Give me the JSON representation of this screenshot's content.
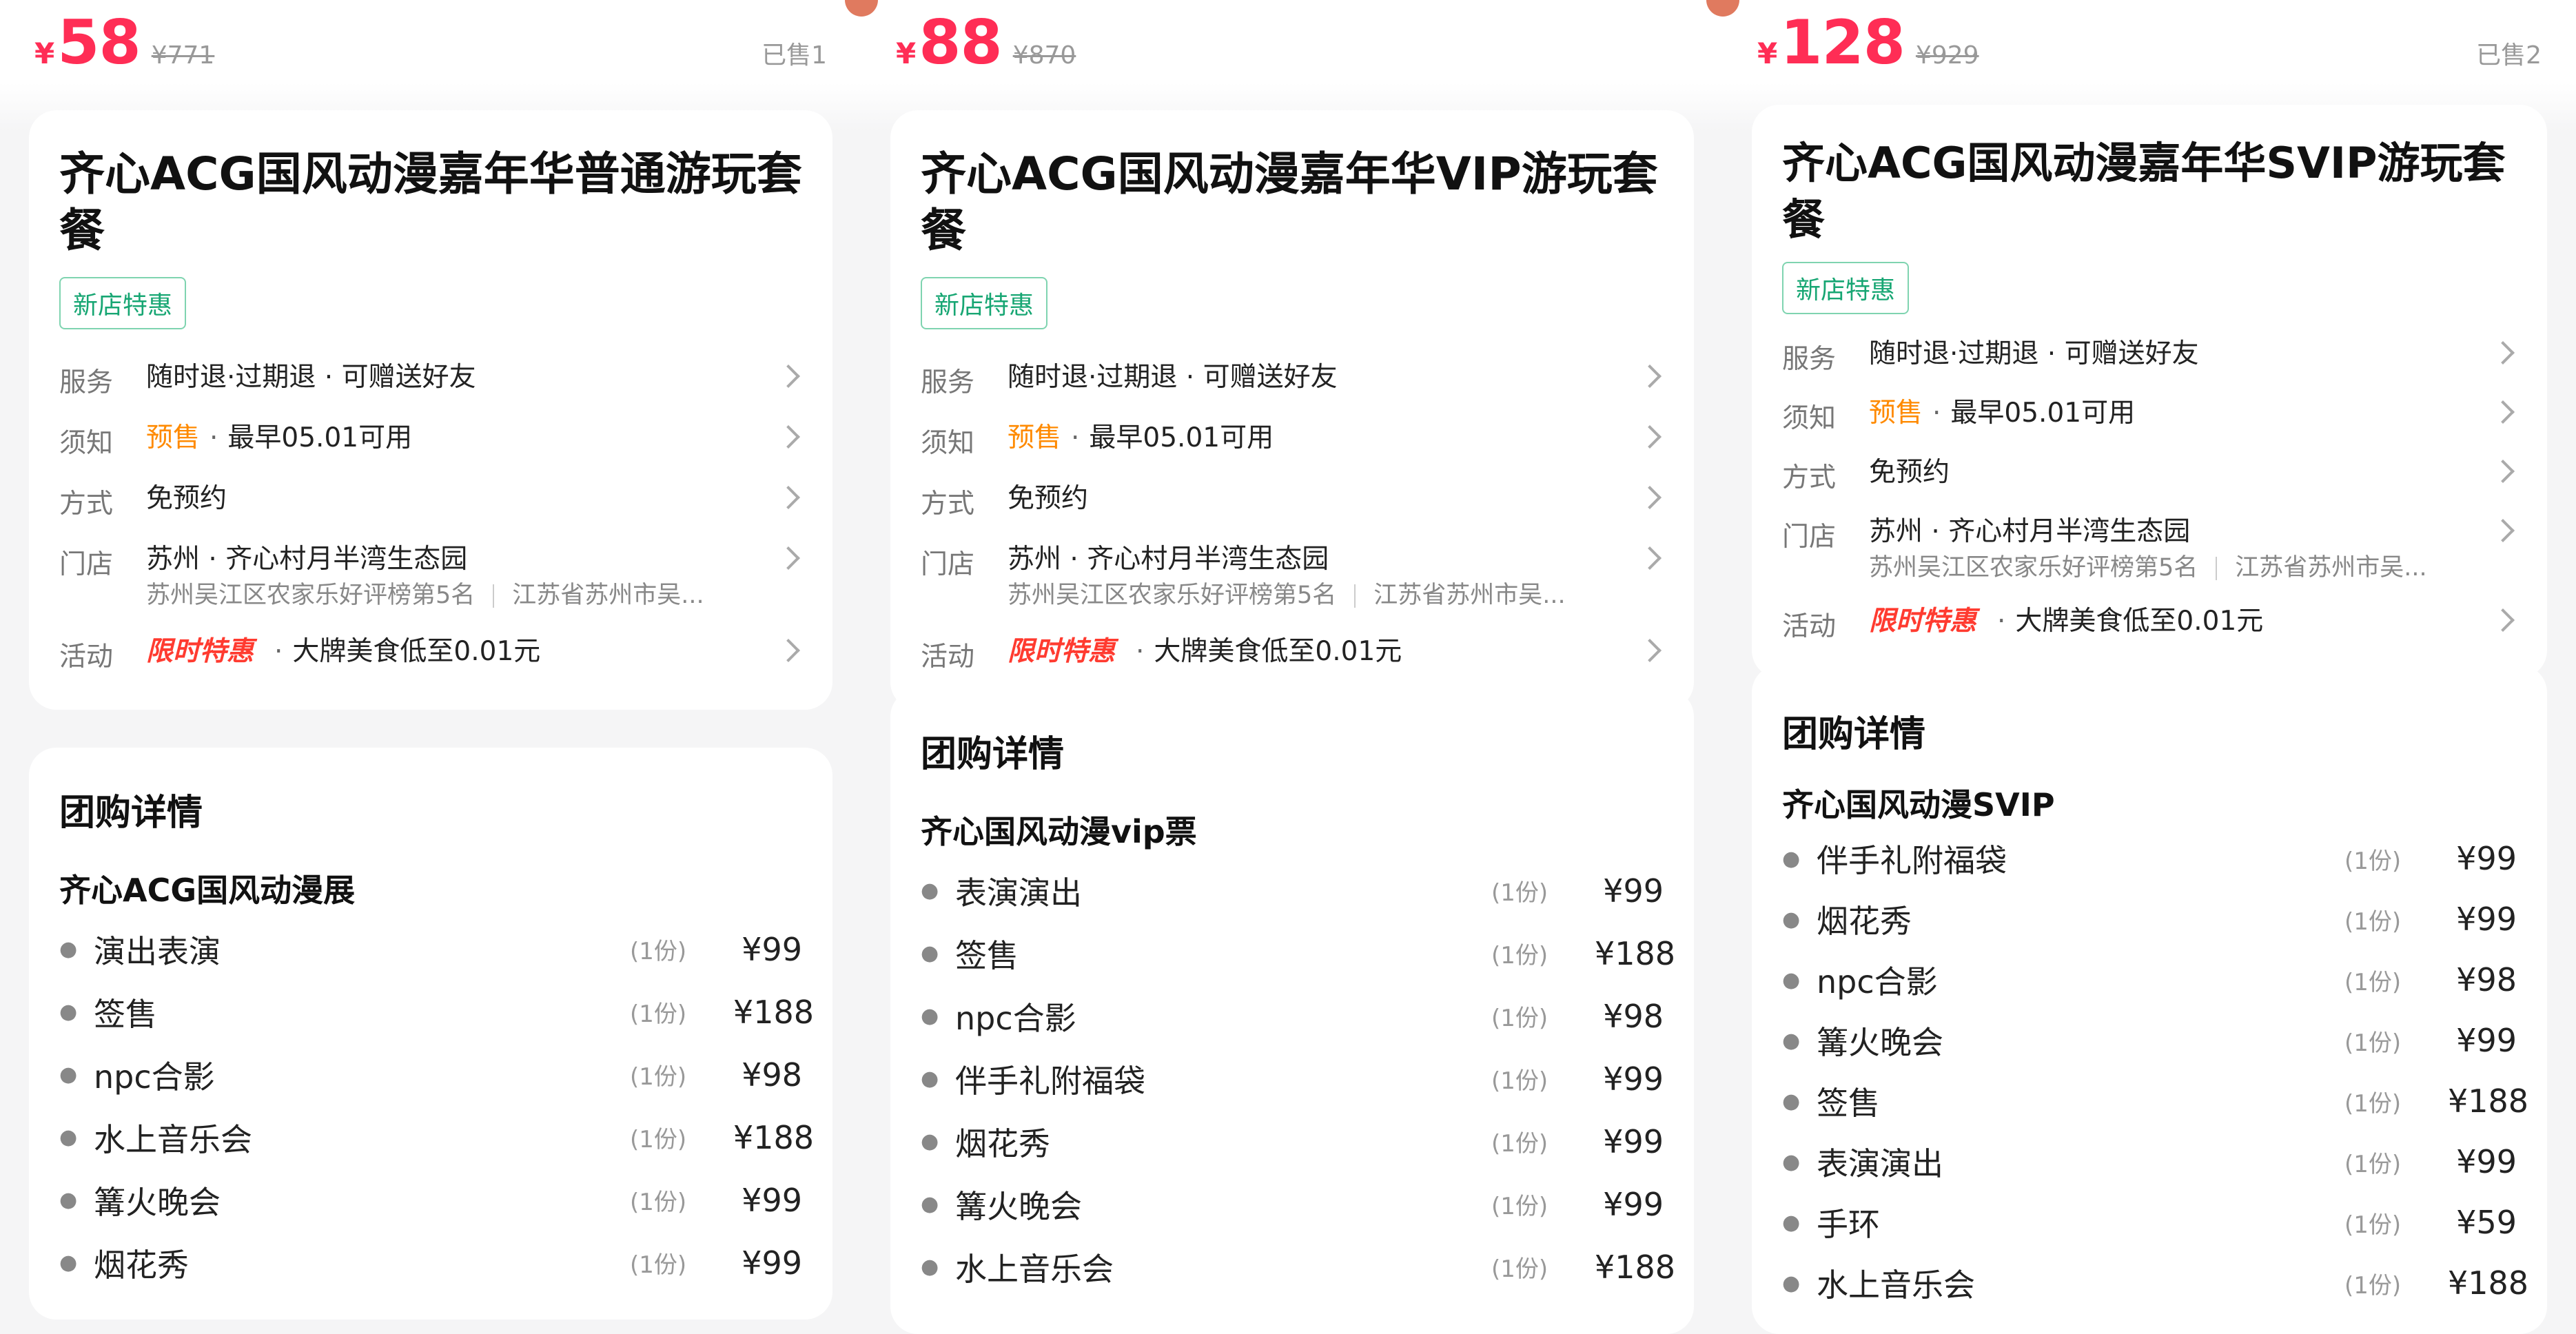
{
  "accent_color": "#ff2d55",
  "columns": [
    {
      "currency": "¥",
      "price": "58",
      "original_price": "¥771",
      "sold": "已售1",
      "title": "齐心ACG国风动漫嘉年华普通游玩套餐",
      "tag": "新店特惠",
      "service_label": "服务",
      "service_value": "随时退·过期退 · 可赠送好友",
      "notice_label": "须知",
      "notice_highlight": "预售",
      "notice_value": "最早05.01可用",
      "method_label": "方式",
      "method_value": "免预约",
      "store_label": "门店",
      "store_value": "苏州 · 齐心村月半湾生态园",
      "store_rank": "苏州吴江区农家乐好评榜第5名",
      "store_addr": "江苏省苏州市吴...",
      "activity_label": "活动",
      "activity_highlight": "限时特惠",
      "activity_value": "大牌美食低至0.01元",
      "detail_heading": "团购详情",
      "package_name": "齐心ACG国风动漫展",
      "items": [
        {
          "name": "演出表演",
          "qty": "(1份)",
          "price": "¥99"
        },
        {
          "name": "签售",
          "qty": "(1份)",
          "price": "¥188"
        },
        {
          "name": "npc合影",
          "qty": "(1份)",
          "price": "¥98"
        },
        {
          "name": "水上音乐会",
          "qty": "(1份)",
          "price": "¥188"
        },
        {
          "name": "篝火晚会",
          "qty": "(1份)",
          "price": "¥99"
        },
        {
          "name": "烟花秀",
          "qty": "(1份)",
          "price": "¥99"
        }
      ]
    },
    {
      "currency": "¥",
      "price": "88",
      "original_price": "¥870",
      "sold": "",
      "title": "齐心ACG国风动漫嘉年华VIP游玩套餐",
      "tag": "新店特惠",
      "service_label": "服务",
      "service_value": "随时退·过期退 · 可赠送好友",
      "notice_label": "须知",
      "notice_highlight": "预售",
      "notice_value": "最早05.01可用",
      "method_label": "方式",
      "method_value": "免预约",
      "store_label": "门店",
      "store_value": "苏州 · 齐心村月半湾生态园",
      "store_rank": "苏州吴江区农家乐好评榜第5名",
      "store_addr": "江苏省苏州市吴...",
      "activity_label": "活动",
      "activity_highlight": "限时特惠",
      "activity_value": "大牌美食低至0.01元",
      "detail_heading": "团购详情",
      "package_name": "齐心国风动漫vip票",
      "items": [
        {
          "name": "表演演出",
          "qty": "(1份)",
          "price": "¥99"
        },
        {
          "name": "签售",
          "qty": "(1份)",
          "price": "¥188"
        },
        {
          "name": "npc合影",
          "qty": "(1份)",
          "price": "¥98"
        },
        {
          "name": "伴手礼附福袋",
          "qty": "(1份)",
          "price": "¥99"
        },
        {
          "name": "烟花秀",
          "qty": "(1份)",
          "price": "¥99"
        },
        {
          "name": "篝火晚会",
          "qty": "(1份)",
          "price": "¥99"
        },
        {
          "name": "水上音乐会",
          "qty": "(1份)",
          "price": "¥188"
        }
      ]
    },
    {
      "currency": "¥",
      "price": "128",
      "original_price": "¥929",
      "sold": "已售2",
      "title": "齐心ACG国风动漫嘉年华SVIP游玩套餐",
      "tag": "新店特惠",
      "service_label": "服务",
      "service_value": "随时退·过期退 · 可赠送好友",
      "notice_label": "须知",
      "notice_highlight": "预售",
      "notice_value": "最早05.01可用",
      "method_label": "方式",
      "method_value": "免预约",
      "store_label": "门店",
      "store_value": "苏州 · 齐心村月半湾生态园",
      "store_rank": "苏州吴江区农家乐好评榜第5名",
      "store_addr": "江苏省苏州市吴...",
      "activity_label": "活动",
      "activity_highlight": "限时特惠",
      "activity_value": "大牌美食低至0.01元",
      "detail_heading": "团购详情",
      "package_name": "齐心国风动漫SVIP",
      "items": [
        {
          "name": "伴手礼附福袋",
          "qty": "(1份)",
          "price": "¥99"
        },
        {
          "name": "烟花秀",
          "qty": "(1份)",
          "price": "¥99"
        },
        {
          "name": "npc合影",
          "qty": "(1份)",
          "price": "¥98"
        },
        {
          "name": "篝火晚会",
          "qty": "(1份)",
          "price": "¥99"
        },
        {
          "name": "签售",
          "qty": "(1份)",
          "price": "¥188"
        },
        {
          "name": "表演演出",
          "qty": "(1份)",
          "price": "¥99"
        },
        {
          "name": "手环",
          "qty": "(1份)",
          "price": "¥59"
        },
        {
          "name": "水上音乐会",
          "qty": "(1份)",
          "price": "¥188"
        }
      ]
    }
  ]
}
